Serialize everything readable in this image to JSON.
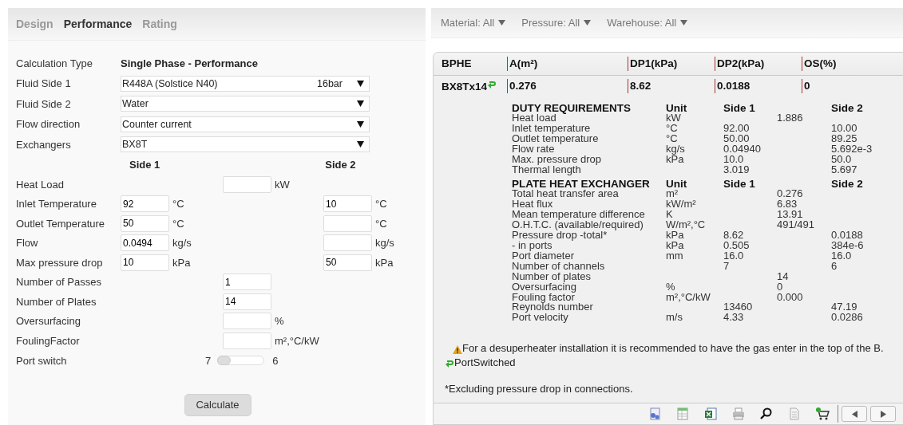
{
  "tabs": [
    {
      "label": "Design",
      "selected": false
    },
    {
      "label": "Performance",
      "selected": true
    },
    {
      "label": "Rating",
      "selected": false
    }
  ],
  "form": {
    "calculation_type": {
      "label": "Calculation Type",
      "value": "Single Phase - Performance"
    },
    "selects": [
      {
        "label": "Fluid Side 1",
        "value": "R448A (Solstice N40)",
        "extra": "16bar"
      },
      {
        "label": "Fluid Side 2",
        "value": "Water"
      },
      {
        "label": "Flow direction",
        "value": "Counter current"
      },
      {
        "label": "Exchangers",
        "value": "BX8T"
      }
    ],
    "side_headers": [
      "Side 1",
      "Side 2"
    ],
    "fields": [
      {
        "kind": "single",
        "label": "Heat Load",
        "unit": "kW"
      },
      {
        "kind": "sides",
        "label": "Inlet Temperature",
        "side_1": "92",
        "unit_1": "°C",
        "side_2": "10",
        "unit_2": "°C"
      },
      {
        "kind": "sides",
        "label": "Outlet Temperature",
        "side_1": "50",
        "unit_1": "°C",
        "unit_2": "°C"
      },
      {
        "kind": "sides",
        "label": "Flow",
        "side_1": "0.0494",
        "unit_1": "kg/s",
        "unit_2": "kg/s"
      },
      {
        "kind": "sides",
        "label": "Max pressure drop",
        "side_1": "10",
        "unit_1": "kPa",
        "side_2": "50",
        "unit_2": "kPa"
      },
      {
        "kind": "single",
        "label": "Number of Passes",
        "value": "1"
      },
      {
        "kind": "single",
        "label": "Number of Plates",
        "value": "14"
      },
      {
        "kind": "single",
        "label": "Oversurfacing",
        "unit": "%"
      },
      {
        "kind": "single",
        "label": "FoulingFactor",
        "unit": "m²,°C/kW"
      },
      {
        "kind": "slider",
        "label": "Port switch",
        "min_label": "7",
        "max_label": "6",
        "level": 0
      }
    ],
    "calculate_button": "Calculate"
  },
  "filters": [
    {
      "label": "Material:",
      "value": "All"
    },
    {
      "label": "Pressure:",
      "value": "All"
    },
    {
      "label": "Warehouse:",
      "value": "All"
    }
  ],
  "results": {
    "columns": [
      "BPHE",
      "A(m²)",
      "DP1(kPa)",
      "DP2(kPa)",
      "OS(%)"
    ],
    "row": {
      "cells": [
        "BX8Tx14",
        "0.276",
        "8.62",
        "0.0188",
        "0"
      ],
      "port_switched": true
    },
    "sections": [
      {
        "title": "DUTY REQUIREMENTS",
        "headers": [
          "Unit",
          "Side 1",
          "Side 2"
        ],
        "rows": [
          {
            "label": "Heat load",
            "unit": "kW",
            "both": "1.886"
          },
          {
            "label": "Inlet temperature",
            "unit": "°C",
            "side_1": "92.00",
            "side_2": "10.00"
          },
          {
            "label": "Outlet temperature",
            "unit": "°C",
            "side_1": "50.00",
            "side_2": "89.25"
          },
          {
            "label": "Flow rate",
            "unit": "kg/s",
            "side_1": "0.04940",
            "side_2": "5.692e-3"
          },
          {
            "label": "Max. pressure drop",
            "unit": "kPa",
            "side_1": "10.0",
            "side_2": "50.0"
          },
          {
            "label": "Thermal length",
            "side_1": "3.019",
            "side_2": "5.697"
          }
        ]
      },
      {
        "title": "PLATE HEAT EXCHANGER",
        "headers": [
          "Unit",
          "Side 1",
          "Side 2"
        ],
        "rows": [
          {
            "label": "Total heat transfer area",
            "unit": "m²",
            "both": "0.276"
          },
          {
            "label": "Heat flux",
            "unit": "kW/m²",
            "both": "6.83"
          },
          {
            "label": "Mean temperature difference",
            "unit": "K",
            "both": "13.91"
          },
          {
            "label": "O.H.T.C. (available/required)",
            "unit": "W/m²,°C",
            "both": "491/491"
          },
          {
            "label": "Pressure drop -total*",
            "unit": "kPa",
            "side_1": "8.62",
            "side_2": "0.0188"
          },
          {
            "label": "- in ports",
            "unit": "kPa",
            "side_1": "0.505",
            "side_2": "384e-6"
          },
          {
            "label": "Port diameter",
            "unit": "mm",
            "side_1": "16.0",
            "side_2": "16.0"
          },
          {
            "label": "Number of channels",
            "side_1": "7",
            "side_2": "6"
          },
          {
            "label": "Number of plates",
            "both": "14"
          },
          {
            "label": "Oversurfacing",
            "unit": "%",
            "both": "0"
          },
          {
            "label": "Fouling factor",
            "unit": "m²,°C/kW",
            "both": "0.000"
          },
          {
            "label": "Reynolds number",
            "side_1": "13460",
            "side_2": "47.19"
          },
          {
            "label": "Port velocity",
            "unit": "m/s",
            "side_1": "4.33",
            "side_2": "0.0286"
          }
        ]
      }
    ],
    "messages": [
      {
        "kind": "warning",
        "text": "For a desuperheater installation it is recommended to have the gas enter in the top of the B."
      },
      {
        "kind": "port",
        "text": "PortSwitched"
      }
    ],
    "footnote": "*Excluding pressure drop in connections."
  }
}
